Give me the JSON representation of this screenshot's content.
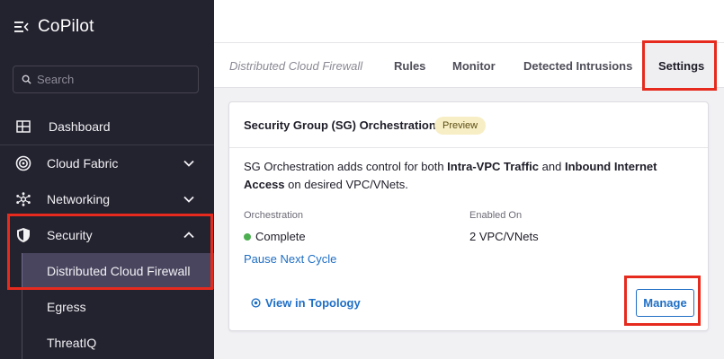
{
  "app": {
    "title": "CoPilot"
  },
  "search": {
    "placeholder": "Search"
  },
  "sidebar": {
    "items": [
      {
        "label": "Dashboard",
        "icon": "dashboard-icon"
      },
      {
        "label": "Cloud Fabric",
        "icon": "cloud-fabric-icon",
        "expanded": false
      },
      {
        "label": "Networking",
        "icon": "networking-icon",
        "expanded": false
      },
      {
        "label": "Security",
        "icon": "shield-icon",
        "expanded": true
      }
    ],
    "security_subitems": [
      {
        "label": "Distributed Cloud Firewall",
        "active": true
      },
      {
        "label": "Egress",
        "active": false
      },
      {
        "label": "ThreatIQ",
        "active": false
      }
    ]
  },
  "tabs": {
    "breadcrumb": "Distributed Cloud Firewall",
    "items": [
      {
        "label": "Rules"
      },
      {
        "label": "Monitor"
      },
      {
        "label": "Detected Intrusions"
      },
      {
        "label": "Settings",
        "active": true
      }
    ]
  },
  "card": {
    "title": "Security Group (SG) Orchestration",
    "badge": "Preview",
    "desc_part1": "SG Orchestration adds control for both ",
    "desc_bold1": "Intra-VPC Traffic",
    "desc_part2": " and ",
    "desc_bold2": "Inbound Internet Access",
    "desc_part3": " on desired VPC/VNets.",
    "orchestration_label": "Orchestration",
    "orchestration_value": "Complete",
    "orchestration_status_color": "#4caf50",
    "enabled_on_label": "Enabled On",
    "enabled_on_value": "2 VPC/VNets",
    "pause_link": "Pause Next Cycle",
    "topology_link": "View in Topology",
    "manage_button": "Manage"
  },
  "colors": {
    "sidebar_bg": "#23222f",
    "active_item_bg": "#49455f",
    "link": "#1f6fc5",
    "highlight": "#e62b1e",
    "badge_bg": "#f7eec5"
  }
}
